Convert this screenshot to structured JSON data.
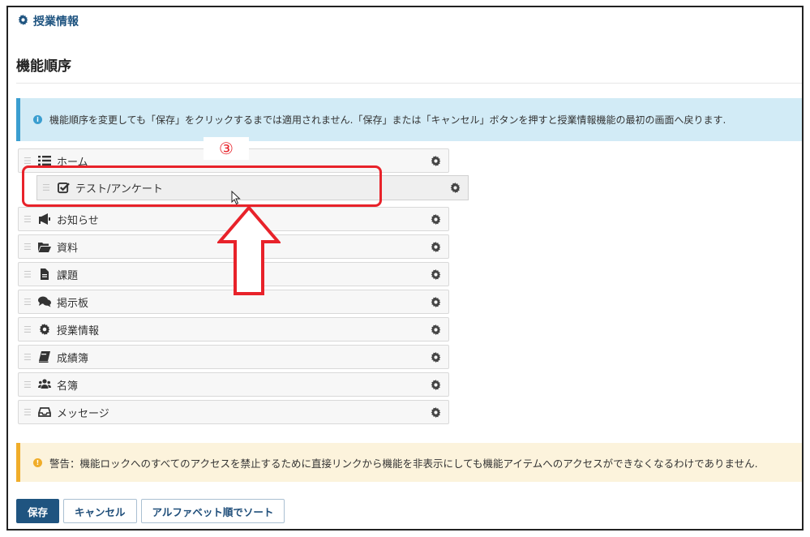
{
  "breadcrumb": {
    "icon": "gear-icon",
    "label": "授業情報"
  },
  "page": {
    "title": "機能順序"
  },
  "info_alert": {
    "icon": "info-icon",
    "text": "機能順序を変更しても「保存」をクリックするまでは適用されません.「保存」または「キャンセル」ボタンを押すと授業情報機能の最初の画面へ戻ります."
  },
  "tools": [
    {
      "name": "home",
      "label": "ホーム",
      "icon": "list-icon"
    },
    {
      "name": "announcements",
      "label": "お知らせ",
      "icon": "megaphone-icon"
    },
    {
      "name": "resources",
      "label": "資料",
      "icon": "folder-open-icon"
    },
    {
      "name": "assignments",
      "label": "課題",
      "icon": "file-icon"
    },
    {
      "name": "forums",
      "label": "掲示板",
      "icon": "comments-icon"
    },
    {
      "name": "syllabus",
      "label": "授業情報",
      "icon": "gear-icon"
    },
    {
      "name": "gradebook",
      "label": "成績簿",
      "icon": "book-icon"
    },
    {
      "name": "roster",
      "label": "名簿",
      "icon": "users-icon"
    },
    {
      "name": "messages",
      "label": "メッセージ",
      "icon": "inbox-icon"
    }
  ],
  "dragging_item": {
    "label": "テスト/アンケート",
    "icon": "checkbox-icon"
  },
  "annotation": {
    "marker": "③"
  },
  "warning_alert": {
    "icon": "warning-icon",
    "text": "警告：機能ロックへのすべてのアクセスを禁止するために直接リンクから機能を非表示にしても機能アイテムへのアクセスができなくなるわけでありません."
  },
  "buttons": {
    "save": "保存",
    "cancel": "キャンセル",
    "sort": "アルファベット順でソート"
  },
  "colors": {
    "accent": "#1f5480",
    "annotation": "#e8222a",
    "info": "#3a9ed0",
    "warning": "#f0ad2a"
  }
}
